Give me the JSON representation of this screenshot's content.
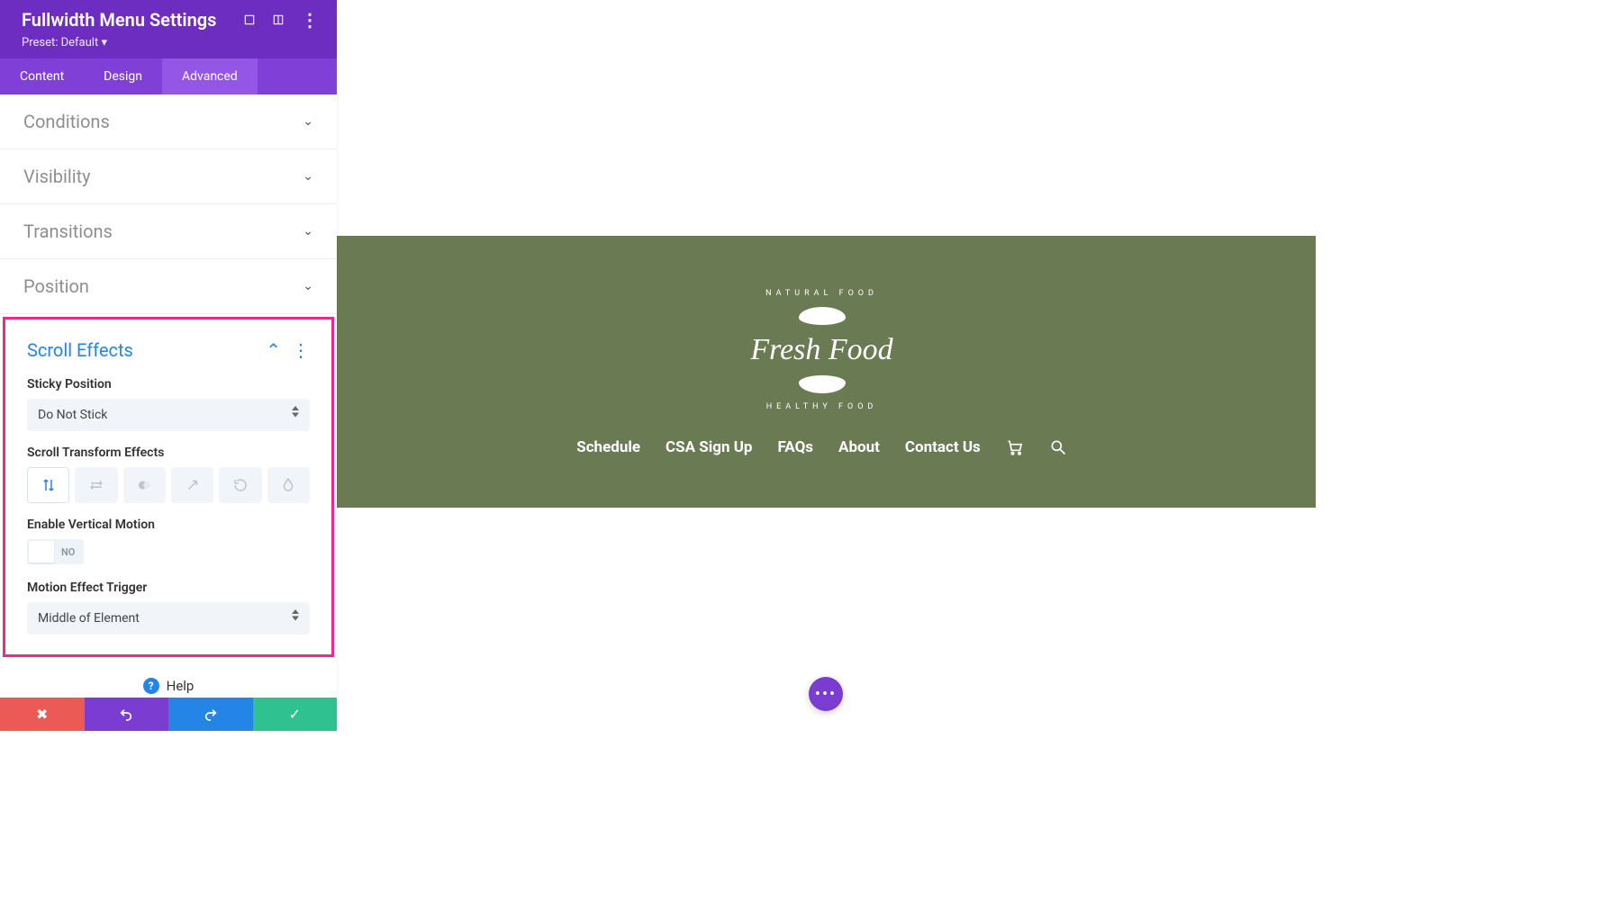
{
  "panel": {
    "title": "Fullwidth Menu Settings",
    "preset": "Preset: Default",
    "tabs": {
      "content": "Content",
      "design": "Design",
      "advanced": "Advanced"
    },
    "sections": {
      "conditions": "Conditions",
      "visibility": "Visibility",
      "transitions": "Transitions",
      "position": "Position"
    },
    "scroll_effects": {
      "title": "Scroll Effects",
      "sticky_label": "Sticky Position",
      "sticky_value": "Do Not Stick",
      "transform_label": "Scroll Transform Effects",
      "vmotion_label": "Enable Vertical Motion",
      "vmotion_value": "NO",
      "trigger_label": "Motion Effect Trigger",
      "trigger_value": "Middle of Element"
    },
    "help": "Help"
  },
  "preview": {
    "logo_top": "NATURAL FOOD",
    "logo_name": "Fresh Food",
    "logo_bottom": "HEALTHY FOOD",
    "nav": [
      "Schedule",
      "CSA Sign Up",
      "FAQs",
      "About",
      "Contact Us"
    ]
  }
}
